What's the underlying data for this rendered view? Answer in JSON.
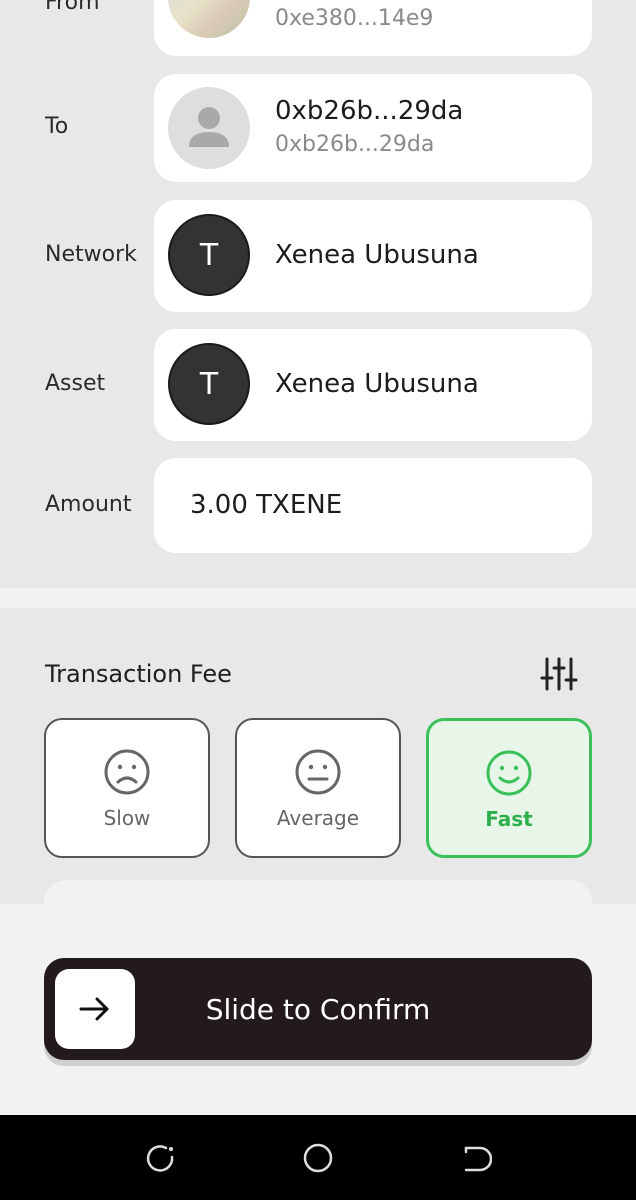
{
  "from": {
    "label": "From",
    "address": "0xe380...14e9"
  },
  "to": {
    "label": "To",
    "name": "0xb26b...29da",
    "address": "0xb26b...29da"
  },
  "network": {
    "label": "Network",
    "avatar_letter": "T",
    "name": "Xenea Ubusuna"
  },
  "asset": {
    "label": "Asset",
    "avatar_letter": "T",
    "name": "Xenea Ubusuna"
  },
  "amount": {
    "label": "Amount",
    "value": "3.00 TXENE"
  },
  "fee": {
    "title": "Transaction Fee",
    "settings_icon": "sliders-icon",
    "options": [
      {
        "label": "Slow",
        "icon": "frown-face-icon",
        "selected": false
      },
      {
        "label": "Average",
        "icon": "neutral-face-icon",
        "selected": false
      },
      {
        "label": "Fast",
        "icon": "smile-face-icon",
        "selected": true
      }
    ],
    "accent_color": "#3cc05a"
  },
  "confirm": {
    "label": "Slide to Confirm",
    "icon": "arrow-right-icon"
  },
  "navbar": {
    "icons": [
      "recent-apps-icon",
      "home-icon",
      "back-icon"
    ]
  }
}
